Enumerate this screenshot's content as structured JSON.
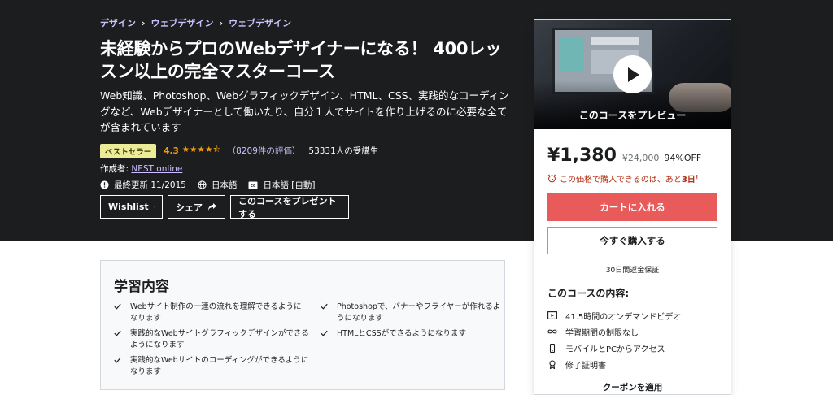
{
  "breadcrumb": [
    "デザイン",
    "ウェブデザイン",
    "ウェブデザイン"
  ],
  "course": {
    "title": "未経験からプロのWebデザイナーになる！ 400レッスン以上の完全マスターコース",
    "subtitle": "Web知識、Photoshop、Webグラフィックデザイン、HTML、CSS、実践的なコーディングなど、Webデザイナーとして働いたり、自分１人でサイトを作り上げるのに必要な全てが含まれています",
    "badge": "ベストセラー",
    "rating": "4.3",
    "stars": "★★★★⯪",
    "rating_count": "（8209件の評価）",
    "students": "53331人の受講生",
    "creator_label": "作成者: ",
    "creator_name": "NEST online",
    "last_updated": "最終更新 11/2015",
    "language": "日本語",
    "captions": "日本語 [自動]"
  },
  "actions": {
    "wishlist": "Wishlist",
    "share": "シェア",
    "gift": "このコースをプレゼントする"
  },
  "sidebar": {
    "preview_label": "このコースをプレビュー",
    "price": "¥1,380",
    "original_price": "¥24,000",
    "discount": "94%OFF",
    "timer_prefix": "この価格で購入できるのは、あと",
    "timer_value": "3日",
    "timer_suffix": "!",
    "cart_button": "カートに入れる",
    "buy_button": "今すぐ購入する",
    "guarantee": "30日間返金保証",
    "includes_title": "このコースの内容:",
    "includes": [
      {
        "icon": "video-icon",
        "label": "41.5時間のオンデマンドビデオ"
      },
      {
        "icon": "infinity-icon",
        "label": "学習期間の制限なし"
      },
      {
        "icon": "mobile-icon",
        "label": "モバイルとPCからアクセス"
      },
      {
        "icon": "certificate-icon",
        "label": "修了証明書"
      }
    ],
    "coupon": "クーポンを適用"
  },
  "learn": {
    "title": "学習内容",
    "items_left": [
      "Webサイト制作の一連の流れを理解できるようになります",
      "実践的なWebサイトグラフィックデザインができるようになります",
      "実践的なWebサイトのコーディングができるようになります"
    ],
    "items_right": [
      "Photoshopで、バナーやフライヤーが作れるようになります",
      "HTMLとCSSができるようになります"
    ]
  },
  "colors": {
    "hero_bg": "#1c1d1f",
    "accent_link": "#cec0fc",
    "star": "#f69c08",
    "cart_button": "#e95a5a",
    "timer": "#b32d0f",
    "badge_bg": "#eceb98"
  }
}
